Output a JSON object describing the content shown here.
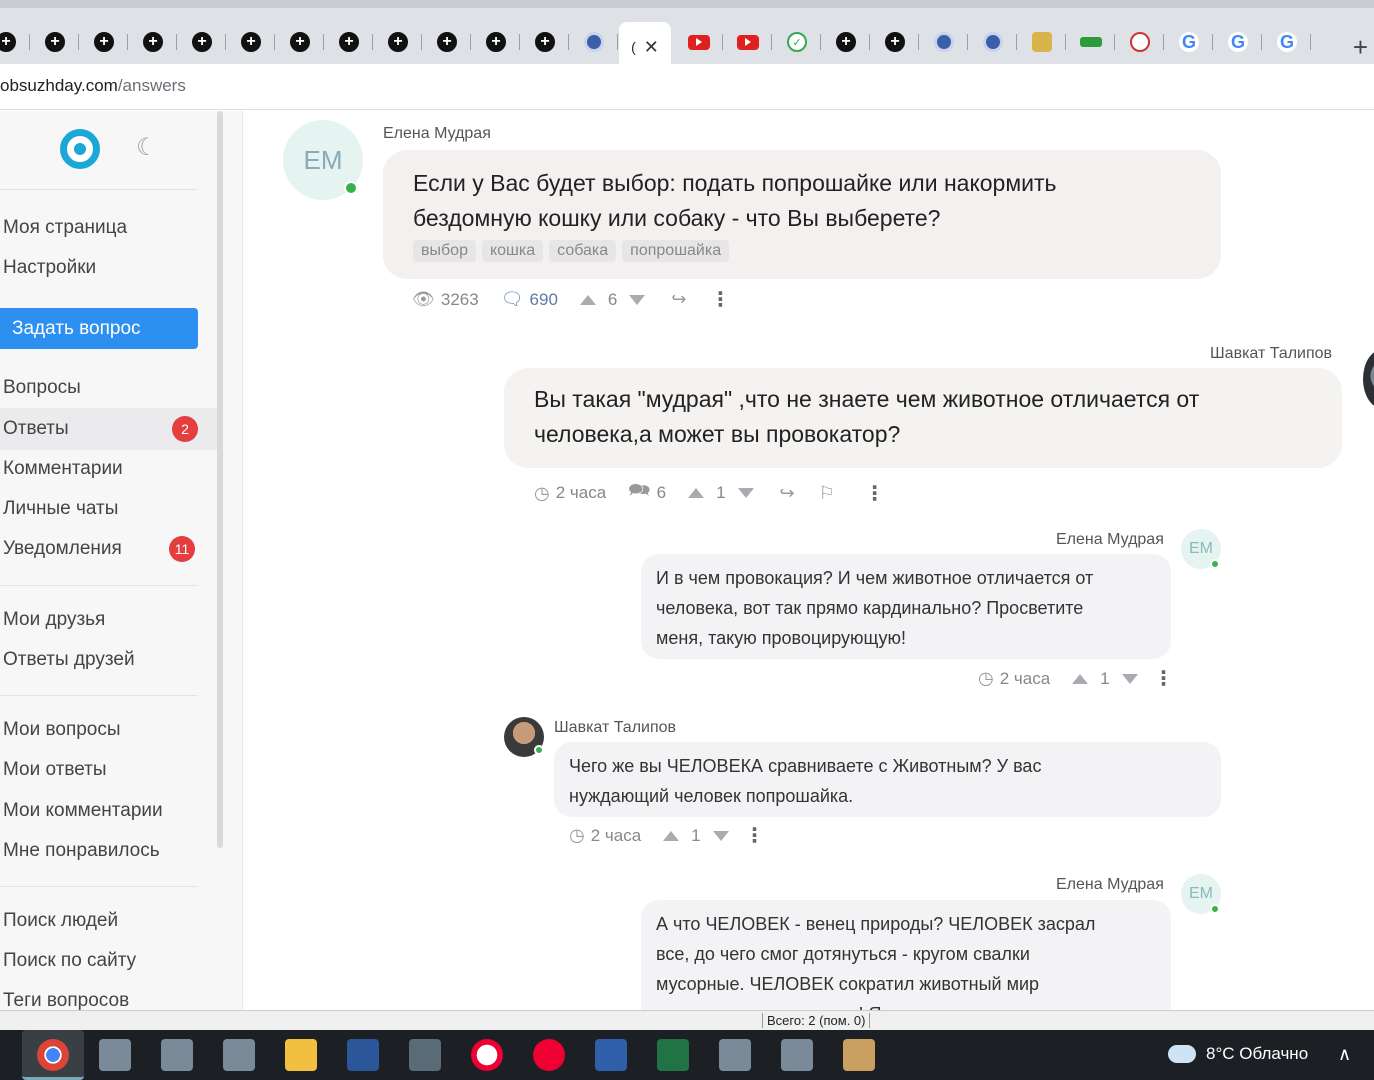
{
  "browser": {
    "tabs": [
      {
        "icon": "site-icon-dark"
      },
      {
        "icon": "site-icon-dark"
      },
      {
        "icon": "site-icon-dark"
      },
      {
        "icon": "site-icon-dark"
      },
      {
        "icon": "site-icon-dark"
      },
      {
        "icon": "site-icon-dark"
      },
      {
        "icon": "site-icon-dark"
      },
      {
        "icon": "site-icon-dark"
      },
      {
        "icon": "site-icon-dark"
      },
      {
        "icon": "site-icon-dark"
      },
      {
        "icon": "site-icon-dark"
      },
      {
        "icon": "site-icon-dark"
      },
      {
        "icon": "emblem-icon"
      },
      {
        "icon": "active-tab",
        "active": true
      },
      {
        "icon": "youtube-icon"
      },
      {
        "icon": "youtube-icon"
      },
      {
        "icon": "check-icon"
      },
      {
        "icon": "site-icon-dark"
      },
      {
        "icon": "site-icon-dark"
      },
      {
        "icon": "emblem-icon"
      },
      {
        "icon": "emblem-icon"
      },
      {
        "icon": "coat-of-arms-icon"
      },
      {
        "icon": "green-logo-icon"
      },
      {
        "icon": "red-logo-icon"
      },
      {
        "icon": "google-icon"
      },
      {
        "icon": "google-icon"
      },
      {
        "icon": "google-icon"
      }
    ],
    "active_tab_label": "(",
    "new_tab": "+",
    "url_host": "obsuzhday.com",
    "url_path": "/answers"
  },
  "sidebar": {
    "items_top": [
      {
        "label": "Моя страница"
      },
      {
        "label": "Настройки"
      }
    ],
    "ask_button": "Задать вопрос",
    "items_main": [
      {
        "label": "Вопросы"
      },
      {
        "label": "Ответы",
        "badge": "2",
        "active": true
      },
      {
        "label": "Комментарии"
      },
      {
        "label": "Личные чаты"
      },
      {
        "label": "Уведомления",
        "badge": "11"
      }
    ],
    "items_friends": [
      {
        "label": "Мои друзья"
      },
      {
        "label": "Ответы друзей"
      }
    ],
    "items_mine": [
      {
        "label": "Мои вопросы"
      },
      {
        "label": "Мои ответы"
      },
      {
        "label": "Мои комментарии"
      },
      {
        "label": "Мне понравилось"
      }
    ],
    "items_search": [
      {
        "label": "Поиск людей"
      },
      {
        "label": "Поиск по сайту"
      },
      {
        "label": "Теги вопросов"
      }
    ]
  },
  "question": {
    "author": "Елена Мудрая",
    "initials": "ЕМ",
    "text": "Если у Вас будет выбор: подать попрошайке или накормить бездомную кошку или собаку - что Вы выберете?",
    "tags": [
      "выбор",
      "кошка",
      "собака",
      "попрошайка"
    ],
    "views": "3263",
    "comments": "690",
    "votes": "6"
  },
  "answer": {
    "author": "Шавкат Талипов",
    "text": "Вы такая \"мудрая\" ,что не знаете чем животное отличается от человека,а может вы провокатор?",
    "time": "2 часа",
    "comments": "6",
    "votes": "1"
  },
  "comments": [
    {
      "author": "Елена Мудрая",
      "initials": "ЕМ",
      "lines": [
        "И в чем провокация? И чем животное отличается от",
        "человека, вот так прямо кардинально? Просветите",
        "меня, такую провоцирующую!"
      ],
      "time": "2 часа",
      "votes": "1"
    },
    {
      "author": "Шавкат Талипов",
      "lines": [
        "Чего же вы ЧЕЛОВЕКА сравниваете с Животным? У вас",
        "нуждающий человек попрошайка."
      ],
      "time": "2 часа",
      "votes": "1"
    },
    {
      "author": "Елена Мудрая",
      "initials": "ЕМ",
      "lines": [
        "А что ЧЕЛОВЕК - венец природы? ЧЕЛОВЕК засрал",
        "все, до чего смог дотянуться - кругом свалки",
        "мусорные. ЧЕЛОВЕК сократил животный мир",
        "планеты на сотни видов! Я уже молчу про вольерную"
      ]
    }
  ],
  "statusbar": {
    "text": "Всего: 2 (пом. 0)"
  },
  "taskbar": {
    "weather": "8°C  Облачно",
    "apps": [
      "chrome-icon",
      "app-icon",
      "app-icon",
      "app-icon",
      "folder-icon",
      "word-icon",
      "calculator-icon",
      "yandex-browser-icon",
      "yandex-icon",
      "floppy-icon",
      "excel-icon",
      "app-icon",
      "app-icon",
      "paint-icon"
    ]
  }
}
